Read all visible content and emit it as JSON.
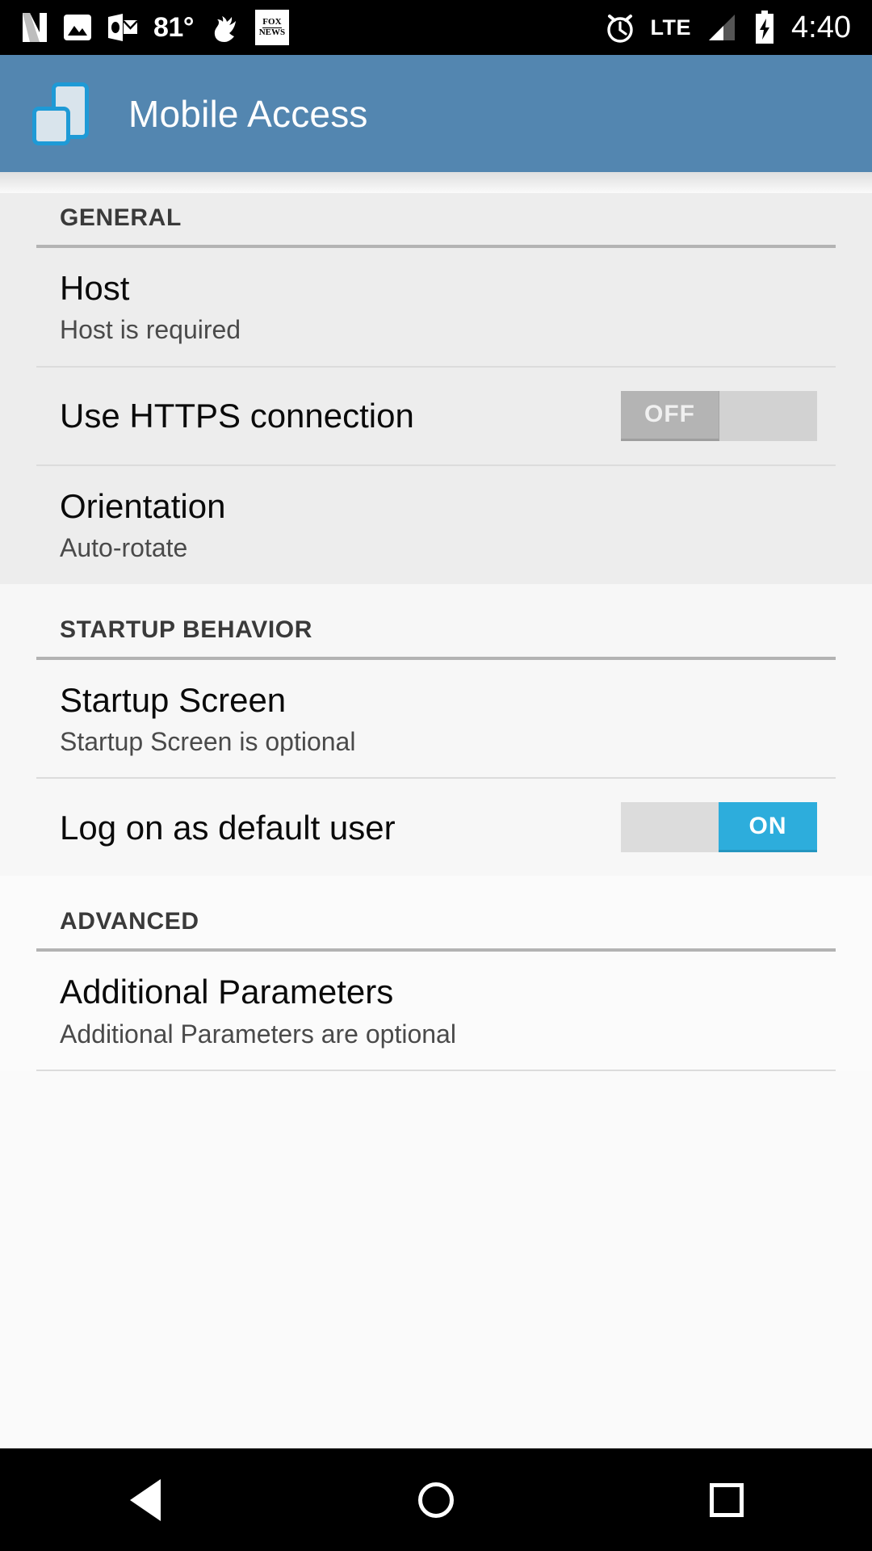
{
  "statusbar": {
    "icons_left": [
      {
        "name": "netflix-icon",
        "label": "N"
      },
      {
        "name": "photos-icon",
        "label": ""
      },
      {
        "name": "outlook-icon",
        "label": "O"
      },
      {
        "name": "temperature-indicator",
        "label": "81°"
      },
      {
        "name": "twitter-bird-icon",
        "label": ""
      },
      {
        "name": "fox-news-icon",
        "label_top": "FOX",
        "label_bottom": "NEWS"
      }
    ],
    "icons_right": [
      {
        "name": "alarm-icon",
        "label": ""
      },
      {
        "name": "network-type-indicator",
        "label": "LTE"
      },
      {
        "name": "signal-strength-icon",
        "label": ""
      },
      {
        "name": "battery-charging-icon",
        "label": ""
      }
    ],
    "clock": "4:40"
  },
  "appbar": {
    "title": "Mobile Access",
    "icon": "mobile-access-app-icon",
    "background_color": "#5386b0"
  },
  "sections": [
    {
      "header": "GENERAL",
      "rows": [
        {
          "title": "Host",
          "summary": "Host is required",
          "control": "none"
        },
        {
          "title": "Use HTTPS connection",
          "summary": "",
          "control": "switch",
          "switch_state": "off",
          "switch_label": "OFF"
        },
        {
          "title": "Orientation",
          "summary": "Auto-rotate",
          "control": "none"
        }
      ]
    },
    {
      "header": "STARTUP BEHAVIOR",
      "rows": [
        {
          "title": "Startup Screen",
          "summary": "Startup Screen is optional",
          "control": "none"
        },
        {
          "title": "Log on as default user",
          "summary": "",
          "control": "switch",
          "switch_state": "on",
          "switch_label": "ON"
        }
      ]
    },
    {
      "header": "ADVANCED",
      "rows": [
        {
          "title": "Additional Parameters",
          "summary": "Additional Parameters are optional",
          "control": "none"
        }
      ]
    }
  ],
  "navbar": {
    "back": "back-button",
    "home": "home-button",
    "recents": "recents-button"
  },
  "colors": {
    "accent": "#2daddc",
    "appbar": "#5386b0",
    "section_rule": "#b3b3b3",
    "divider": "#dcdcdc"
  }
}
